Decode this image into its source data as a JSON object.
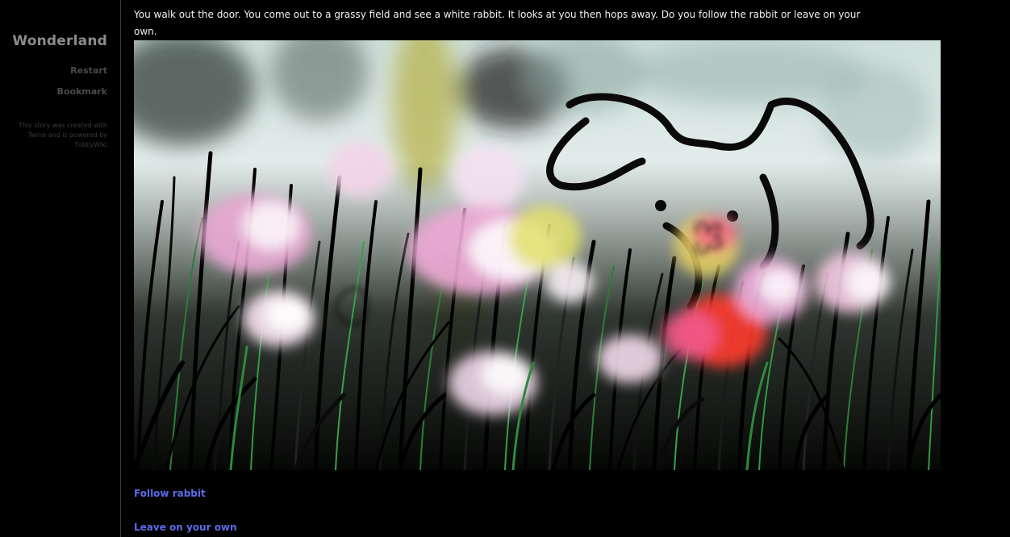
{
  "sidebar": {
    "title": "Wonderland",
    "restart_label": "Restart",
    "bookmark_label": "Bookmark",
    "credits": "This story was created with Twine and is powered by TiddlyWiki"
  },
  "passage": {
    "text": "You walk out the door. You come out to a grassy field and see a white rabbit. It looks at you then hops away. Do you follow the rabbit or leave on your own.",
    "choices": [
      {
        "label": "Follow rabbit"
      },
      {
        "label": "Leave on your own"
      }
    ]
  },
  "colors": {
    "background": "#000000",
    "title": "#8c8c8c",
    "sidebar_link": "#4a4a4a",
    "choice_link": "#5c6be8",
    "passage_text": "#f2f2f2"
  }
}
